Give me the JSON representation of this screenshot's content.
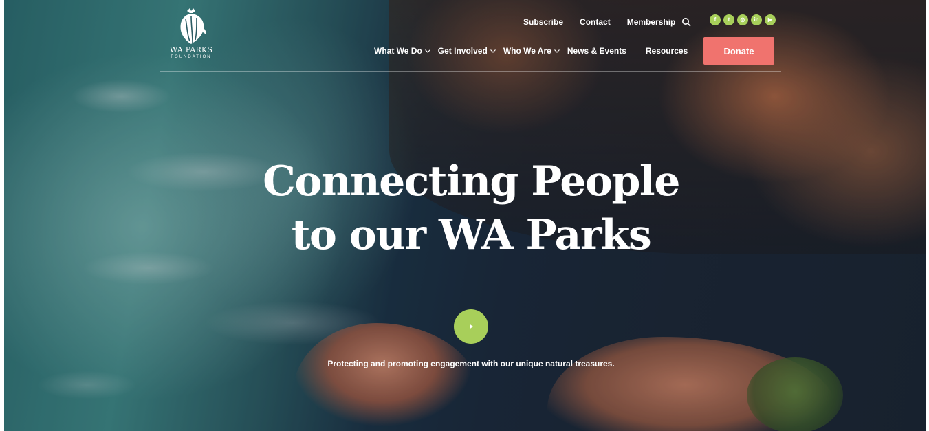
{
  "site": {
    "logo_title": "WA PARKS",
    "logo_subtitle": "FOUNDATION"
  },
  "top_links": {
    "subscribe": "Subscribe",
    "contact": "Contact",
    "membership": "Membership"
  },
  "socials": [
    {
      "icon": "facebook-icon",
      "glyph": "f"
    },
    {
      "icon": "twitter-icon",
      "glyph": "t"
    },
    {
      "icon": "instagram-icon",
      "glyph": "◎"
    },
    {
      "icon": "linkedin-icon",
      "glyph": "in"
    },
    {
      "icon": "youtube-icon",
      "glyph": "▶"
    }
  ],
  "nav": {
    "items": [
      {
        "label": "What We Do",
        "has_dropdown": true
      },
      {
        "label": "Get Involved",
        "has_dropdown": true
      },
      {
        "label": "Who We Are",
        "has_dropdown": true
      },
      {
        "label": "News & Events",
        "has_dropdown": false
      },
      {
        "label": "Resources",
        "has_dropdown": false
      }
    ],
    "donate_label": "Donate"
  },
  "hero": {
    "headline_line1": "Connecting People",
    "headline_line2": "to our WA Parks",
    "tagline": "Protecting and promoting engagement with our unique natural treasures."
  },
  "colors": {
    "accent_green": "#a8cf5a",
    "donate_coral": "#f0736e"
  }
}
